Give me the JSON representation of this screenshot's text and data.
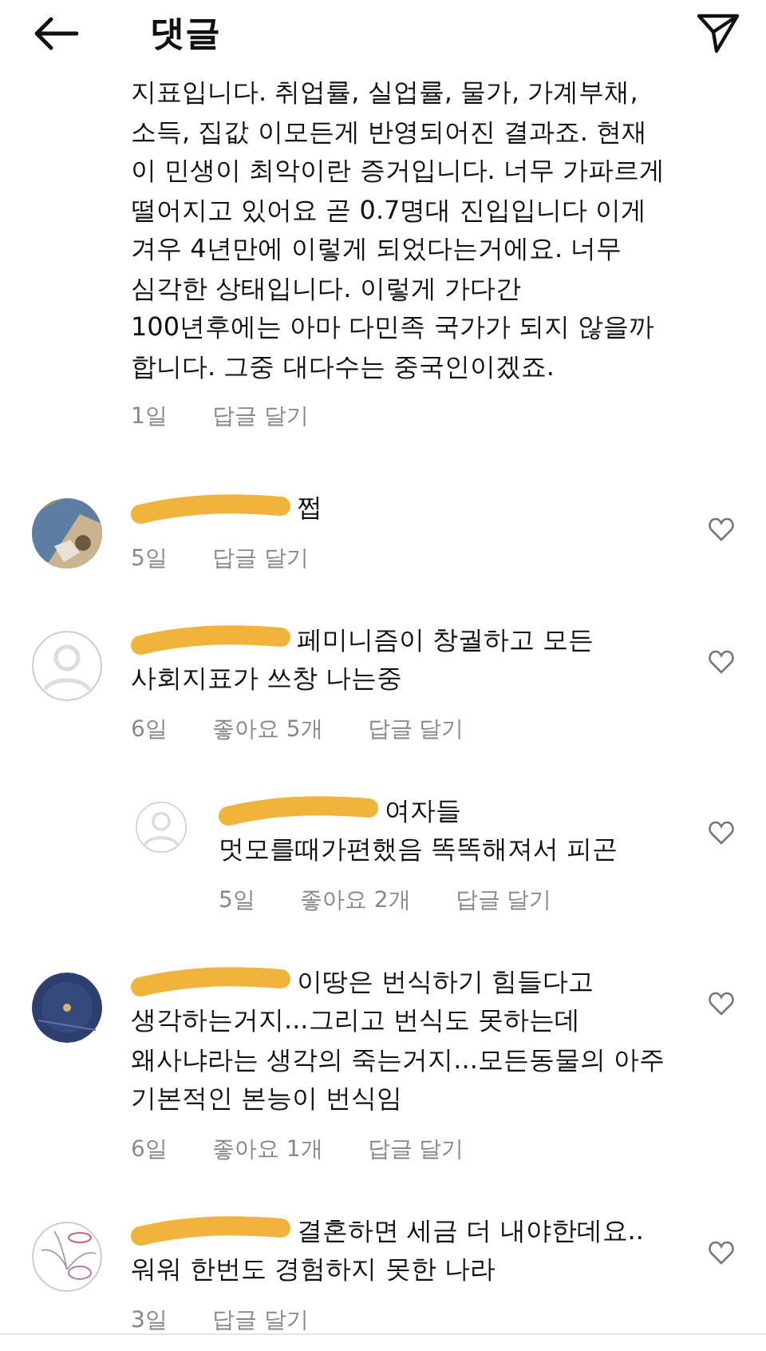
{
  "header": {
    "title": "댓글"
  },
  "comments": [
    {
      "kind": "text",
      "redacted": false,
      "reply": false,
      "heart": false,
      "text": "지표입니다. 취업률, 실업률, 물가, 가계부채, 소득, 집값 이모든게 반영되어진 결과죠. 현재 이 민생이 최악이란 증거입니다. 너무 가파르게 떨어지고 있어요 곧 0.7명대 진입입니다 이게 겨우 4년만에 이렇게 되었다는거에요. 너무 심각한 상태입니다. 이렇게 가다간 100년후에는 아마 다민족 국가가 되지 않을까 합니다. 그중 대다수는 중국인이겠죠.",
      "time": "1일",
      "reply_label": "답글 달기"
    },
    {
      "kind": "photo",
      "redacted": true,
      "reply": false,
      "heart": true,
      "text": "쩝",
      "time": "5일",
      "reply_label": "답글 달기"
    },
    {
      "kind": "default",
      "redacted": true,
      "reply": false,
      "heart": true,
      "text": "페미니즘이 창궐하고 모든 사회지표가 쓰창 나는중",
      "time": "6일",
      "likes": "좋아요 5개",
      "reply_label": "답글 달기"
    },
    {
      "kind": "default",
      "redacted": true,
      "reply": true,
      "heart": true,
      "text": "여자들 멋모를때가편했음 똑똑해져서 피곤",
      "time": "5일",
      "likes": "좋아요 2개",
      "reply_label": "답글 달기"
    },
    {
      "kind": "night",
      "redacted": true,
      "reply": false,
      "heart": true,
      "text": "이땅은 번식하기 힘들다고 생각하는거지...그리고 번식도 못하는데 왜사냐라는 생각의 죽는거지...모든동물의 아주 기본적인 본능이 번식임",
      "time": "6일",
      "likes": "좋아요 1개",
      "reply_label": "답글 달기"
    },
    {
      "kind": "sketch",
      "redacted": true,
      "reply": false,
      "heart": true,
      "text": "결혼하면 세금 더 내야한데요.. 워워 한번도 경험하지 못한 나라",
      "time": "3일",
      "reply_label": "답글 달기"
    }
  ]
}
